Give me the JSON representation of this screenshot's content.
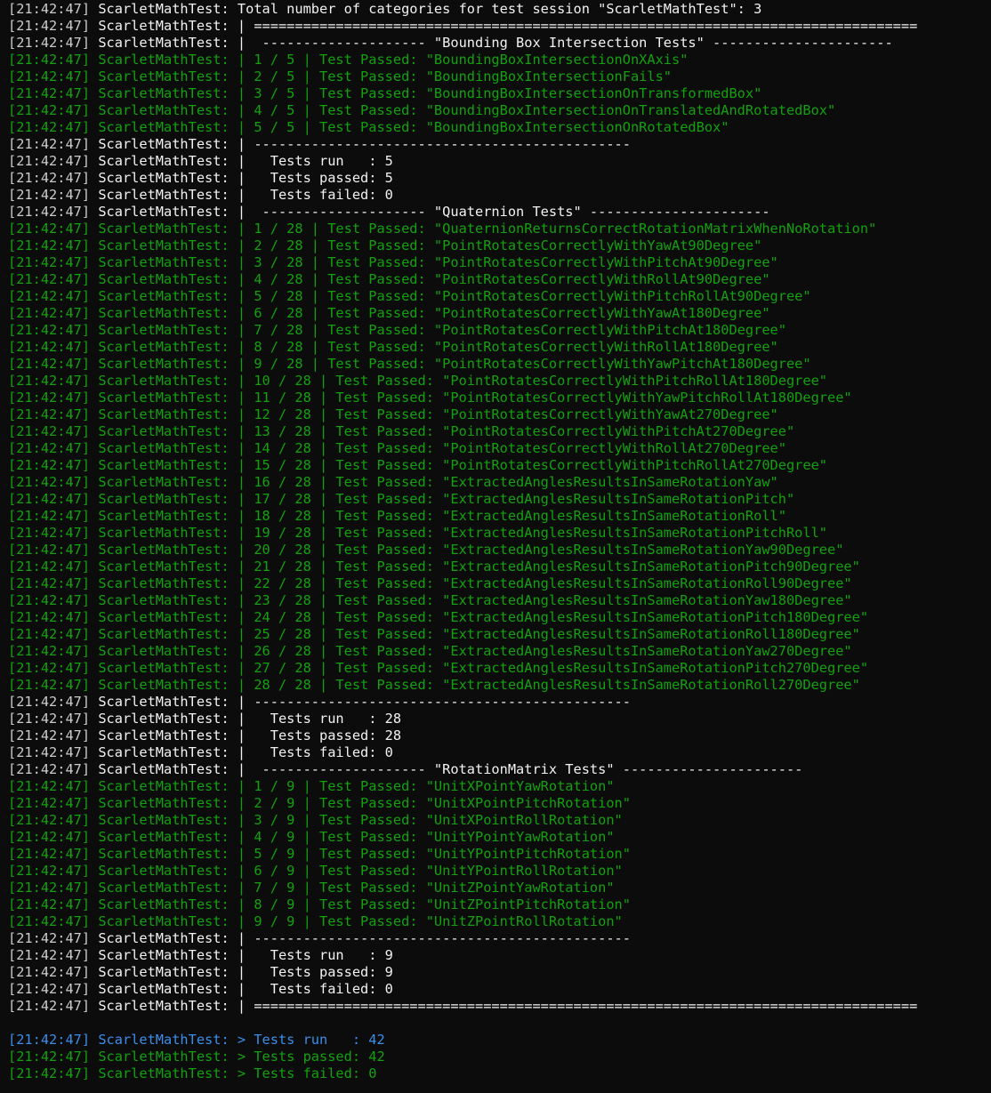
{
  "terminal": {
    "source": "ScarletMathTest:",
    "lines": [
      {
        "ts": "[21:42:47]",
        "msg": "Total number of categories for test session \"ScarletMathTest\": 3",
        "color": "white"
      },
      {
        "ts": "[21:42:47]",
        "msg": "| =================================================================================",
        "color": "white"
      },
      {
        "ts": "[21:42:47]",
        "msg": "|  -------------------- \"Bounding Box Intersection Tests\" ----------------------",
        "color": "white"
      },
      {
        "ts": "[21:42:47]",
        "msg": "| 1 / 5 | Test Passed: \"BoundingBoxIntersectionOnXAxis\"",
        "color": "green"
      },
      {
        "ts": "[21:42:47]",
        "msg": "| 2 / 5 | Test Passed: \"BoundingBoxIntersectionFails\"",
        "color": "green"
      },
      {
        "ts": "[21:42:47]",
        "msg": "| 3 / 5 | Test Passed: \"BoundingBoxIntersectionOnTransformedBox\"",
        "color": "green"
      },
      {
        "ts": "[21:42:47]",
        "msg": "| 4 / 5 | Test Passed: \"BoundingBoxIntersectionOnTranslatedAndRotatedBox\"",
        "color": "green"
      },
      {
        "ts": "[21:42:47]",
        "msg": "| 5 / 5 | Test Passed: \"BoundingBoxIntersectionOnRotatedBox\"",
        "color": "green"
      },
      {
        "ts": "[21:42:47]",
        "msg": "| ----------------------------------------------",
        "color": "white"
      },
      {
        "ts": "[21:42:47]",
        "msg": "|   Tests run   : 5",
        "color": "white"
      },
      {
        "ts": "[21:42:47]",
        "msg": "|   Tests passed: 5",
        "color": "white"
      },
      {
        "ts": "[21:42:47]",
        "msg": "|   Tests failed: 0",
        "color": "white"
      },
      {
        "ts": "[21:42:47]",
        "msg": "|  -------------------- \"Quaternion Tests\" ----------------------",
        "color": "white"
      },
      {
        "ts": "[21:42:47]",
        "msg": "| 1 / 28 | Test Passed: \"QuaternionReturnsCorrectRotationMatrixWhenNoRotation\"",
        "color": "green"
      },
      {
        "ts": "[21:42:47]",
        "msg": "| 2 / 28 | Test Passed: \"PointRotatesCorrectlyWithYawAt90Degree\"",
        "color": "green"
      },
      {
        "ts": "[21:42:47]",
        "msg": "| 3 / 28 | Test Passed: \"PointRotatesCorrectlyWithPitchAt90Degree\"",
        "color": "green"
      },
      {
        "ts": "[21:42:47]",
        "msg": "| 4 / 28 | Test Passed: \"PointRotatesCorrectlyWithRollAt90Degree\"",
        "color": "green"
      },
      {
        "ts": "[21:42:47]",
        "msg": "| 5 / 28 | Test Passed: \"PointRotatesCorrectlyWithPitchRollAt90Degree\"",
        "color": "green"
      },
      {
        "ts": "[21:42:47]",
        "msg": "| 6 / 28 | Test Passed: \"PointRotatesCorrectlyWithYawAt180Degree\"",
        "color": "green"
      },
      {
        "ts": "[21:42:47]",
        "msg": "| 7 / 28 | Test Passed: \"PointRotatesCorrectlyWithPitchAt180Degree\"",
        "color": "green"
      },
      {
        "ts": "[21:42:47]",
        "msg": "| 8 / 28 | Test Passed: \"PointRotatesCorrectlyWithRollAt180Degree\"",
        "color": "green"
      },
      {
        "ts": "[21:42:47]",
        "msg": "| 9 / 28 | Test Passed: \"PointRotatesCorrectlyWithYawPitchAt180Degree\"",
        "color": "green"
      },
      {
        "ts": "[21:42:47]",
        "msg": "| 10 / 28 | Test Passed: \"PointRotatesCorrectlyWithPitchRollAt180Degree\"",
        "color": "green"
      },
      {
        "ts": "[21:42:47]",
        "msg": "| 11 / 28 | Test Passed: \"PointRotatesCorrectlyWithYawPitchRollAt180Degree\"",
        "color": "green"
      },
      {
        "ts": "[21:42:47]",
        "msg": "| 12 / 28 | Test Passed: \"PointRotatesCorrectlyWithYawAt270Degree\"",
        "color": "green"
      },
      {
        "ts": "[21:42:47]",
        "msg": "| 13 / 28 | Test Passed: \"PointRotatesCorrectlyWithPitchAt270Degree\"",
        "color": "green"
      },
      {
        "ts": "[21:42:47]",
        "msg": "| 14 / 28 | Test Passed: \"PointRotatesCorrectlyWithRollAt270Degree\"",
        "color": "green"
      },
      {
        "ts": "[21:42:47]",
        "msg": "| 15 / 28 | Test Passed: \"PointRotatesCorrectlyWithPitchRollAt270Degree\"",
        "color": "green"
      },
      {
        "ts": "[21:42:47]",
        "msg": "| 16 / 28 | Test Passed: \"ExtractedAnglesResultsInSameRotationYaw\"",
        "color": "green"
      },
      {
        "ts": "[21:42:47]",
        "msg": "| 17 / 28 | Test Passed: \"ExtractedAnglesResultsInSameRotationPitch\"",
        "color": "green"
      },
      {
        "ts": "[21:42:47]",
        "msg": "| 18 / 28 | Test Passed: \"ExtractedAnglesResultsInSameRotationRoll\"",
        "color": "green"
      },
      {
        "ts": "[21:42:47]",
        "msg": "| 19 / 28 | Test Passed: \"ExtractedAnglesResultsInSameRotationPitchRoll\"",
        "color": "green"
      },
      {
        "ts": "[21:42:47]",
        "msg": "| 20 / 28 | Test Passed: \"ExtractedAnglesResultsInSameRotationYaw90Degree\"",
        "color": "green"
      },
      {
        "ts": "[21:42:47]",
        "msg": "| 21 / 28 | Test Passed: \"ExtractedAnglesResultsInSameRotationPitch90Degree\"",
        "color": "green"
      },
      {
        "ts": "[21:42:47]",
        "msg": "| 22 / 28 | Test Passed: \"ExtractedAnglesResultsInSameRotationRoll90Degree\"",
        "color": "green"
      },
      {
        "ts": "[21:42:47]",
        "msg": "| 23 / 28 | Test Passed: \"ExtractedAnglesResultsInSameRotationYaw180Degree\"",
        "color": "green"
      },
      {
        "ts": "[21:42:47]",
        "msg": "| 24 / 28 | Test Passed: \"ExtractedAnglesResultsInSameRotationPitch180Degree\"",
        "color": "green"
      },
      {
        "ts": "[21:42:47]",
        "msg": "| 25 / 28 | Test Passed: \"ExtractedAnglesResultsInSameRotationRoll180Degree\"",
        "color": "green"
      },
      {
        "ts": "[21:42:47]",
        "msg": "| 26 / 28 | Test Passed: \"ExtractedAnglesResultsInSameRotationYaw270Degree\"",
        "color": "green"
      },
      {
        "ts": "[21:42:47]",
        "msg": "| 27 / 28 | Test Passed: \"ExtractedAnglesResultsInSameRotationPitch270Degree\"",
        "color": "green"
      },
      {
        "ts": "[21:42:47]",
        "msg": "| 28 / 28 | Test Passed: \"ExtractedAnglesResultsInSameRotationRoll270Degree\"",
        "color": "green"
      },
      {
        "ts": "[21:42:47]",
        "msg": "| ----------------------------------------------",
        "color": "white"
      },
      {
        "ts": "[21:42:47]",
        "msg": "|   Tests run   : 28",
        "color": "white"
      },
      {
        "ts": "[21:42:47]",
        "msg": "|   Tests passed: 28",
        "color": "white"
      },
      {
        "ts": "[21:42:47]",
        "msg": "|   Tests failed: 0",
        "color": "white"
      },
      {
        "ts": "[21:42:47]",
        "msg": "|  -------------------- \"RotationMatrix Tests\" ----------------------",
        "color": "white"
      },
      {
        "ts": "[21:42:47]",
        "msg": "| 1 / 9 | Test Passed: \"UnitXPointYawRotation\"",
        "color": "green"
      },
      {
        "ts": "[21:42:47]",
        "msg": "| 2 / 9 | Test Passed: \"UnitXPointPitchRotation\"",
        "color": "green"
      },
      {
        "ts": "[21:42:47]",
        "msg": "| 3 / 9 | Test Passed: \"UnitXPointRollRotation\"",
        "color": "green"
      },
      {
        "ts": "[21:42:47]",
        "msg": "| 4 / 9 | Test Passed: \"UnitYPointYawRotation\"",
        "color": "green"
      },
      {
        "ts": "[21:42:47]",
        "msg": "| 5 / 9 | Test Passed: \"UnitYPointPitchRotation\"",
        "color": "green"
      },
      {
        "ts": "[21:42:47]",
        "msg": "| 6 / 9 | Test Passed: \"UnitYPointRollRotation\"",
        "color": "green"
      },
      {
        "ts": "[21:42:47]",
        "msg": "| 7 / 9 | Test Passed: \"UnitZPointYawRotation\"",
        "color": "green"
      },
      {
        "ts": "[21:42:47]",
        "msg": "| 8 / 9 | Test Passed: \"UnitZPointPitchRotation\"",
        "color": "green"
      },
      {
        "ts": "[21:42:47]",
        "msg": "| 9 / 9 | Test Passed: \"UnitZPointRollRotation\"",
        "color": "green"
      },
      {
        "ts": "[21:42:47]",
        "msg": "| ----------------------------------------------",
        "color": "white"
      },
      {
        "ts": "[21:42:47]",
        "msg": "|   Tests run   : 9",
        "color": "white"
      },
      {
        "ts": "[21:42:47]",
        "msg": "|   Tests passed: 9",
        "color": "white"
      },
      {
        "ts": "[21:42:47]",
        "msg": "|   Tests failed: 0",
        "color": "white"
      },
      {
        "ts": "[21:42:47]",
        "msg": "| =================================================================================",
        "color": "white"
      },
      {
        "blank": true
      },
      {
        "ts": "[21:42:47]",
        "msg": "> Tests run   : 42",
        "color": "blue"
      },
      {
        "ts": "[21:42:47]",
        "msg": "> Tests passed: 42",
        "color": "green"
      },
      {
        "ts": "[21:42:47]",
        "msg": "> Tests failed: 0",
        "color": "green"
      }
    ]
  }
}
